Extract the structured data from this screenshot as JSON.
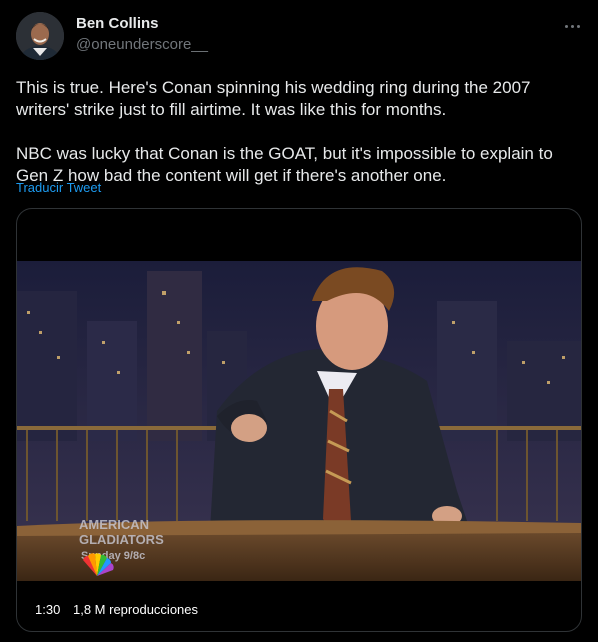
{
  "author": {
    "display_name": "Ben Collins",
    "handle": "@oneunderscore__"
  },
  "tweet": {
    "paragraph_1": "This is true. Here's Conan spinning his wedding ring during the 2007 writers' strike just to fill airtime. It was like this for months.",
    "paragraph_2": "NBC was lucky that Conan is the GOAT, but it's impossible to explain to Gen Z how bad the content will get if there's another one.",
    "translate_label": "Traducir Tweet"
  },
  "video": {
    "duration": "1:30",
    "views": "1,8 M reproducciones",
    "overlay_line_1": "AMERICAN",
    "overlay_line_2": "GLADIATORS",
    "overlay_line_3": "Sunday 9/8c"
  },
  "icons": {
    "more": "more-horizontal-icon",
    "network_logo": "peacock-logo"
  }
}
